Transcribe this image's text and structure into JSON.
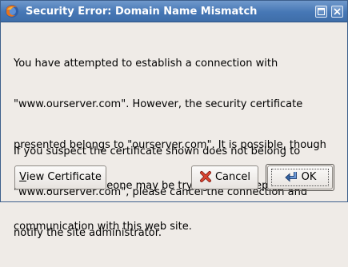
{
  "window": {
    "title": "Security Error: Domain Name Mismatch"
  },
  "message": {
    "paragraph1_lines": [
      "You have attempted to establish a connection with",
      "\"www.ourserver.com\". However, the security certificate",
      "presented belongs to \"ourserver.com\". It is possible, though",
      "unlikely, that someone may be trying to intercept your",
      "communication with this web site."
    ],
    "paragraph2_lines": [
      "If you suspect the certificate shown does not belong to",
      "\"www.ourserver.com\", please cancel the connection and",
      "notify the site administrator."
    ]
  },
  "buttons": {
    "view_certificate_mnemonic": "V",
    "view_certificate_rest": "iew Certificate",
    "cancel_label": "Cancel",
    "ok_label": "OK"
  },
  "icons": {
    "app": "firefox-icon",
    "maximize": "maximize-icon",
    "close": "close-icon",
    "cancel": "cancel-x-icon",
    "ok": "enter-arrow-icon"
  },
  "colors": {
    "titlebar": "#4677b5",
    "cancel_icon": "#c0392b",
    "ok_icon": "#3465a4"
  }
}
